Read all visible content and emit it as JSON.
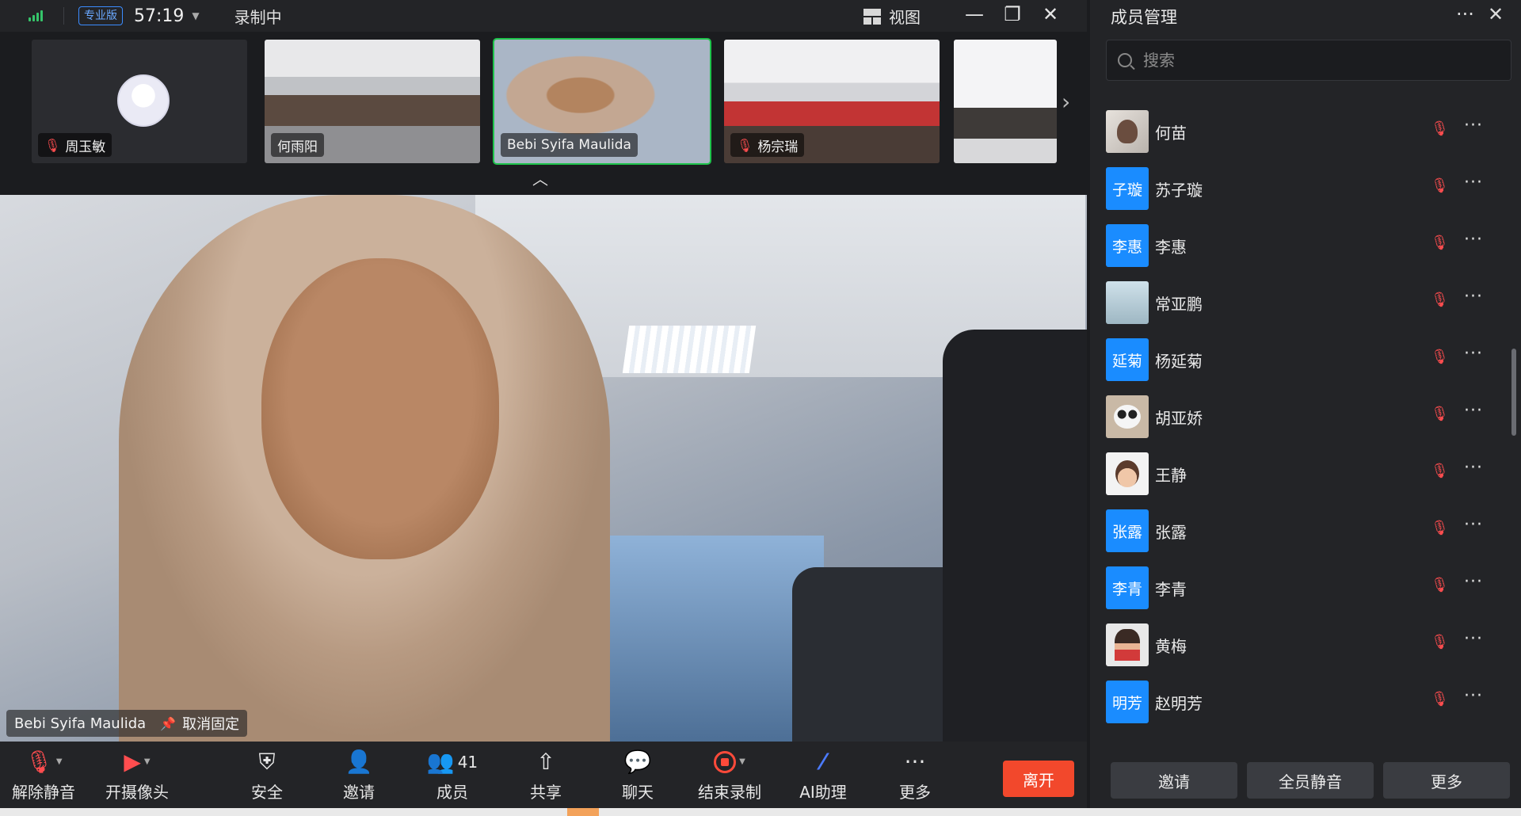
{
  "topbar": {
    "edition_badge": "专业版",
    "timer": "57:19",
    "recording_status": "录制中",
    "view_label": "视图"
  },
  "thumbnails": [
    {
      "name": "周玉敏",
      "muted": true
    },
    {
      "name": "何雨阳",
      "muted": false
    },
    {
      "name": "Bebi Syifa Maulida",
      "muted": false,
      "active": true
    },
    {
      "name": "杨宗瑞",
      "muted": true
    },
    {
      "name": "",
      "muted": false
    }
  ],
  "main_video": {
    "speaker_name": "Bebi Syifa Maulida",
    "unpin_label": "取消固定"
  },
  "toolbar": {
    "unmute": "解除静音",
    "camera": "开摄像头",
    "security": "安全",
    "invite": "邀请",
    "members": "成员",
    "member_count": "41",
    "share": "共享",
    "chat": "聊天",
    "end_recording": "结束录制",
    "ai_assistant": "AI助理",
    "more": "更多",
    "leave": "离开"
  },
  "panel": {
    "title": "成员管理",
    "search_placeholder": "搜索",
    "members": [
      {
        "name": "何苗",
        "avatar": "photo",
        "avatar_text": ""
      },
      {
        "name": "苏子璇",
        "avatar": "text",
        "avatar_text": "子璇"
      },
      {
        "name": "李惠",
        "avatar": "text",
        "avatar_text": "李惠"
      },
      {
        "name": "常亚鹏",
        "avatar": "landscape",
        "avatar_text": ""
      },
      {
        "name": "杨延菊",
        "avatar": "text",
        "avatar_text": "延菊"
      },
      {
        "name": "胡亚娇",
        "avatar": "panda",
        "avatar_text": ""
      },
      {
        "name": "王静",
        "avatar": "cartoon",
        "avatar_text": ""
      },
      {
        "name": "张露",
        "avatar": "text",
        "avatar_text": "张露"
      },
      {
        "name": "李青",
        "avatar": "text",
        "avatar_text": "李青"
      },
      {
        "name": "黄梅",
        "avatar": "redshirt",
        "avatar_text": ""
      },
      {
        "name": "赵明芳",
        "avatar": "text",
        "avatar_text": "明芳"
      }
    ],
    "invite_button": "邀请",
    "mute_all_button": "全员静音",
    "more_button": "更多"
  },
  "colors": {
    "accent_green": "#1ec34b",
    "leave_red": "#f2482c",
    "avatar_blue": "#1a8cff",
    "muted_red": "#ff4d4f"
  }
}
